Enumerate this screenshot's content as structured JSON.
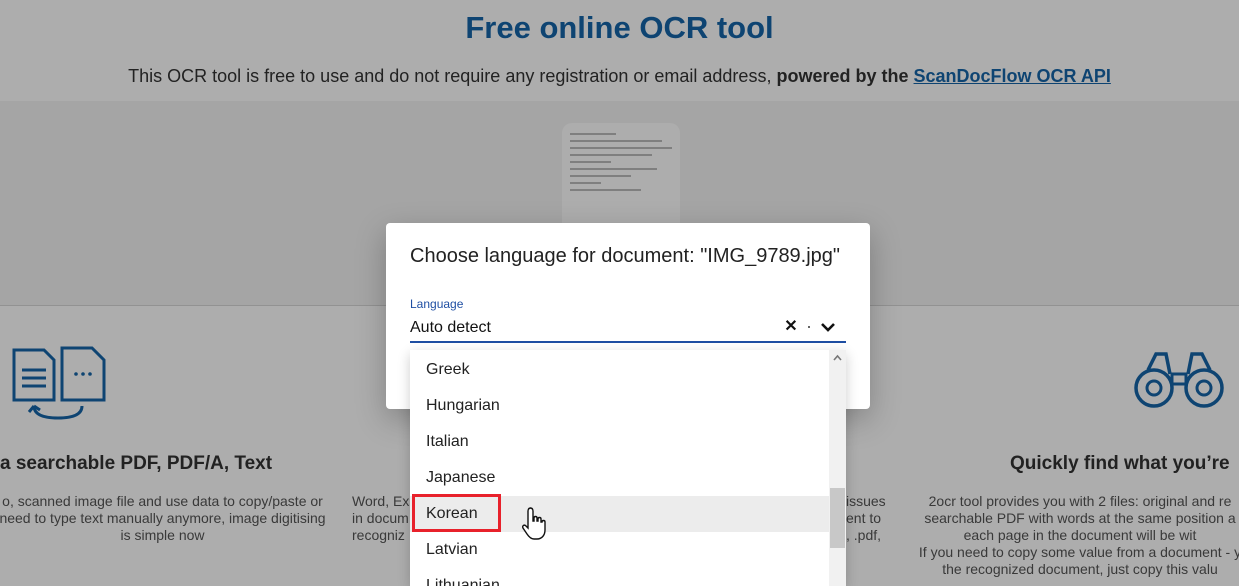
{
  "page": {
    "title": "Free online OCR tool",
    "subtitle_prefix": "This OCR tool is free to use and do not require any registration or email address,",
    "subtitle_bold": "powered by the",
    "subtitle_link": "ScanDocFlow OCR API"
  },
  "features": [
    {
      "title": "a searchable PDF, PDF/A, Text",
      "lines": [
        "o, scanned image file and use data to copy/paste or",
        "need to type text manually anymore, image digitising",
        "is simple now"
      ]
    },
    {
      "title": "",
      "lines": [
        "Word, Ex",
        "in docum",
        "recogniz"
      ]
    },
    {
      "title": "",
      "lines": [
        "issues",
        "ent to",
        ", .pdf,"
      ]
    },
    {
      "title": "Quickly find what you’re",
      "lines": [
        "2ocr tool provides you with 2 files: original and re",
        "searchable PDF with words at the same position a",
        "each page in the document will be wit",
        "If you need to copy some value from a document - y",
        "the recognized document, just copy this valu"
      ]
    }
  ],
  "dialog": {
    "title": "Choose language for document: \"IMG_9789.jpg\"",
    "field_label": "Language",
    "field_value": "Auto detect",
    "clear_symbol": "✕"
  },
  "dropdown": {
    "options": [
      "Greek",
      "Hungarian",
      "Italian",
      "Japanese",
      "Korean",
      "Latvian",
      "Lithuanian"
    ],
    "hovered_index": 4
  },
  "colors": {
    "brand_blue": "#1565a8",
    "label_blue": "#1f4fa3",
    "highlight_red": "#e8212b"
  }
}
